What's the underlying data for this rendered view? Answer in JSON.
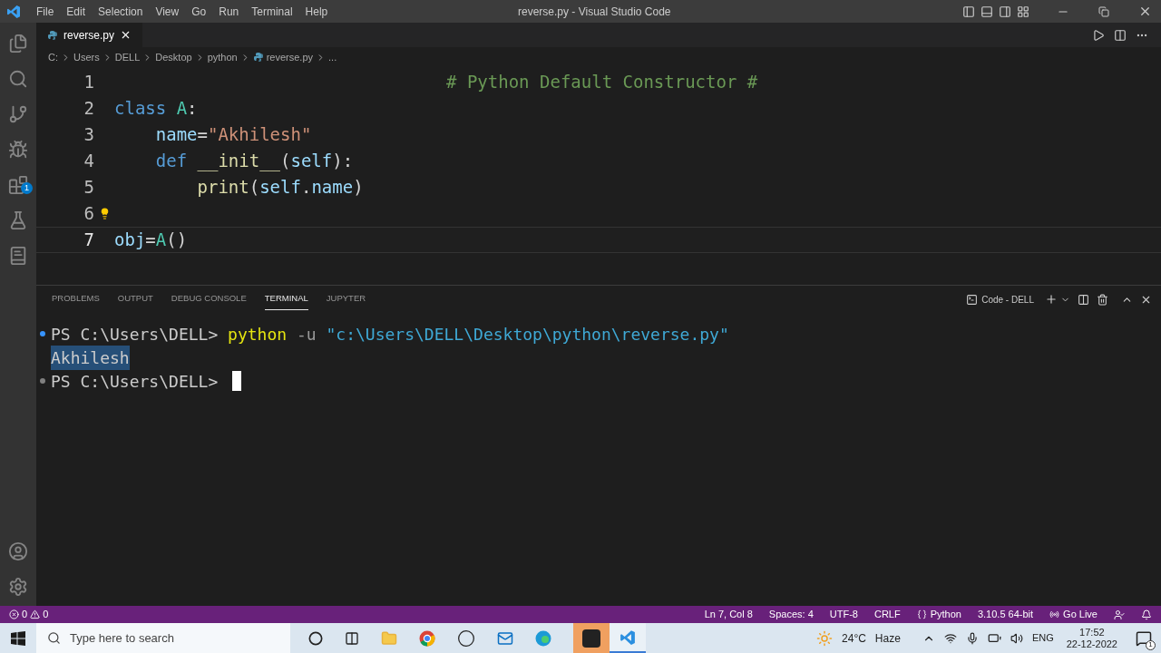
{
  "menu": [
    "File",
    "Edit",
    "Selection",
    "View",
    "Go",
    "Run",
    "Terminal",
    "Help"
  ],
  "window": {
    "title": "reverse.py - Visual Studio Code"
  },
  "activity_bar": {
    "extensions_badge": "1"
  },
  "tabs": [
    {
      "label": "reverse.py",
      "selected": true
    }
  ],
  "breadcrumb": [
    "C:",
    "Users",
    "DELL",
    "Desktop",
    "python",
    "reverse.py",
    "..."
  ],
  "code": [
    {
      "number": "1",
      "current": false,
      "lightbulb": false,
      "tokens": [
        {
          "text": "                                # Python Default Constructor #",
          "kind": "comment"
        }
      ]
    },
    {
      "number": "2",
      "current": false,
      "lightbulb": false,
      "tokens": [
        {
          "text": "class ",
          "kind": "keyword"
        },
        {
          "text": "A",
          "kind": "class"
        },
        {
          "text": ":",
          "kind": "plain"
        }
      ]
    },
    {
      "number": "3",
      "current": false,
      "lightbulb": false,
      "tokens": [
        {
          "text": "    name",
          "kind": "variable"
        },
        {
          "text": "=",
          "kind": "plain"
        },
        {
          "text": "\"Akhilesh\"",
          "kind": "string"
        }
      ]
    },
    {
      "number": "4",
      "current": false,
      "lightbulb": false,
      "tokens": [
        {
          "text": "    def ",
          "kind": "keyword"
        },
        {
          "text": "__init__",
          "kind": "function"
        },
        {
          "text": "(",
          "kind": "plain"
        },
        {
          "text": "self",
          "kind": "variable"
        },
        {
          "text": "):",
          "kind": "plain"
        }
      ]
    },
    {
      "number": "5",
      "current": false,
      "lightbulb": false,
      "tokens": [
        {
          "text": "        print",
          "kind": "function"
        },
        {
          "text": "(",
          "kind": "plain"
        },
        {
          "text": "self",
          "kind": "variable"
        },
        {
          "text": ".",
          "kind": "plain"
        },
        {
          "text": "name",
          "kind": "variable"
        },
        {
          "text": ")",
          "kind": "plain"
        }
      ]
    },
    {
      "number": "6",
      "current": false,
      "lightbulb": true
    },
    {
      "number": "7",
      "current": true,
      "lightbulb": false,
      "tokens": [
        {
          "text": "obj",
          "kind": "variable"
        },
        {
          "text": "=",
          "kind": "plain"
        },
        {
          "text": "A",
          "kind": "class"
        },
        {
          "text": "()",
          "kind": "plain"
        }
      ]
    }
  ],
  "panel_tabs": [
    {
      "label": "PROBLEMS",
      "selected": false
    },
    {
      "label": "OUTPUT",
      "selected": false
    },
    {
      "label": "DEBUG CONSOLE",
      "selected": false
    },
    {
      "label": "TERMINAL",
      "selected": true
    },
    {
      "label": "JUPYTER",
      "selected": false
    }
  ],
  "terminal": {
    "profile": "Code - DELL",
    "lines": [
      {
        "kind": "command",
        "prompt": "PS C:\\Users\\DELL>",
        "command": "python",
        "flag": "-u",
        "argument": "\"c:\\Users\\DELL\\Desktop\\python\\reverse.py\""
      },
      {
        "kind": "output",
        "text": "Akhilesh",
        "selected": true
      },
      {
        "kind": "prompt",
        "prompt": "PS C:\\Users\\DELL>",
        "cursor": true
      }
    ]
  },
  "status_bar": {
    "errors": "0",
    "warnings": "0",
    "items": [
      "Ln 7, Col 8",
      "Spaces: 4",
      "UTF-8",
      "CRLF",
      "Python",
      "3.10.5 64-bit",
      "Go Live"
    ]
  },
  "taskbar": {
    "search_placeholder": "Type here to search",
    "temperature": "24°C",
    "weather": "Haze",
    "language": "ENG",
    "time": "17:52",
    "date": "22-12-2022",
    "notifications": "1"
  }
}
